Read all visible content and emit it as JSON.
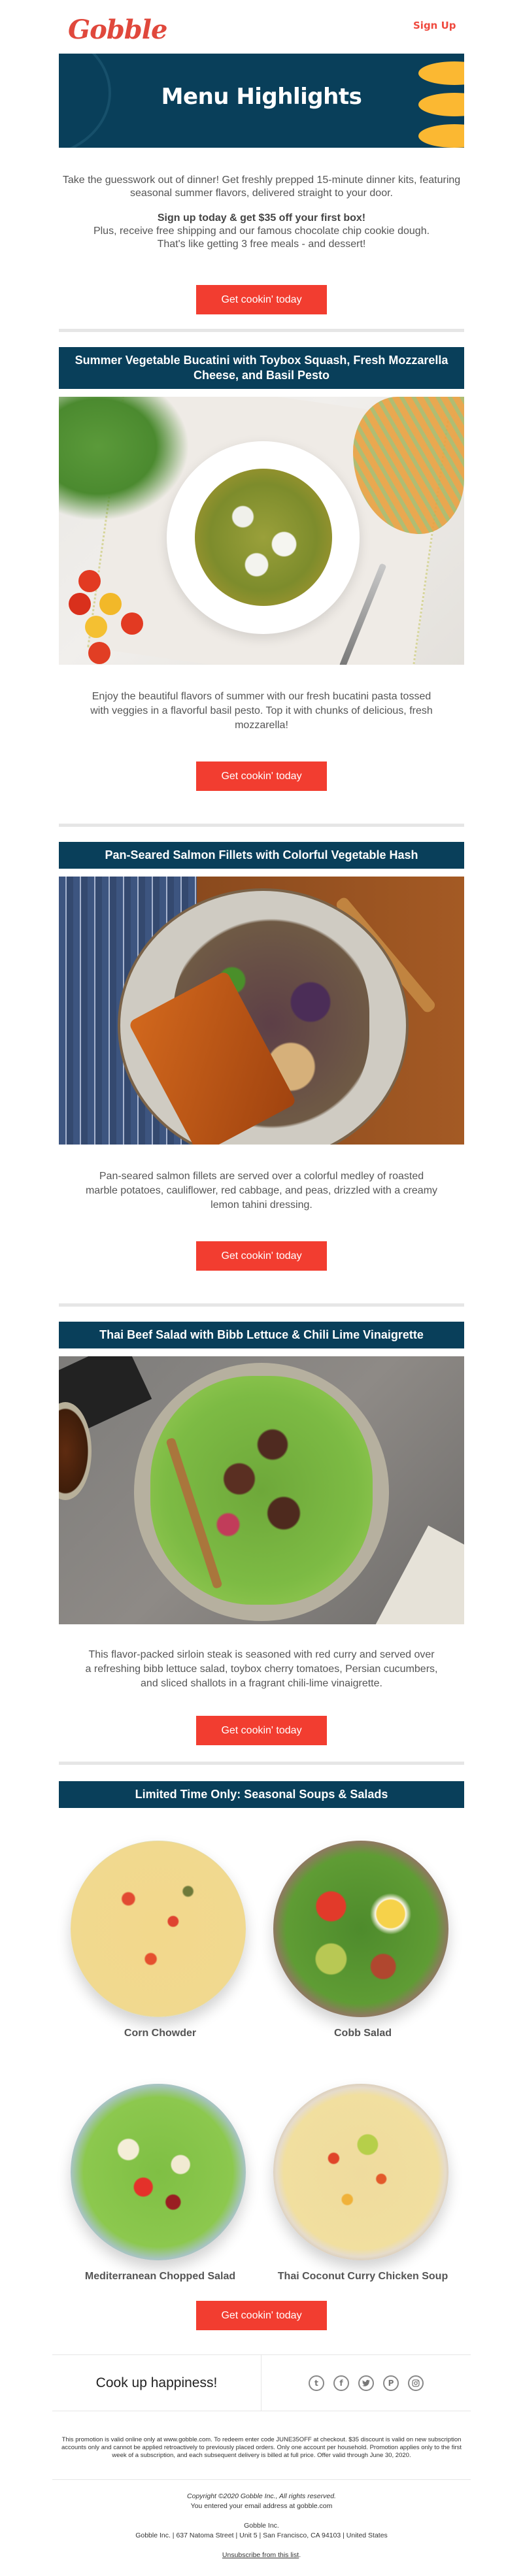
{
  "header": {
    "logo_text": "Gobble",
    "signup_label": "Sign Up"
  },
  "banner": {
    "title": "Menu Highlights",
    "colors": {
      "background": "#093f5a",
      "accent": "#fbb832"
    }
  },
  "intro": {
    "paragraph": "Take the guesswork out of dinner! Get freshly prepped 15-minute dinner kits, featuring seasonal summer flavors, delivered straight to your door.",
    "offer_headline": "Sign up today & get $35 off your first box!",
    "offer_line1": "Plus, receive free shipping and our famous chocolate chip cookie dough.",
    "offer_line2": "That's like getting 3 free meals - and dessert!",
    "cta_label": "Get cookin' today"
  },
  "recipes": [
    {
      "title": "Summer Vegetable Bucatini with Toybox Squash, Fresh Mozzarella Cheese, and Basil Pesto",
      "image_alt": "Bowl of bucatini pasta with vegetables, pesto and mozzarella",
      "description": "Enjoy the beautiful flavors of summer with our fresh bucatini pasta tossed with veggies in a flavorful basil pesto. Top it with chunks of delicious, fresh mozzarella!",
      "cta_label": "Get cookin' today"
    },
    {
      "title": "Pan-Seared Salmon Fillets with Colorful Vegetable Hash",
      "image_alt": "Salmon fillet over roasted vegetable hash",
      "description": "Pan-seared salmon fillets are served over a colorful medley of roasted marble potatoes, cauliflower, red cabbage, and peas, drizzled with a creamy lemon tahini dressing.",
      "cta_label": "Get cookin' today"
    },
    {
      "title": "Thai Beef Salad with Bibb Lettuce & Chili Lime Vinaigrette",
      "image_alt": "Thai beef salad on a plate",
      "description": "This flavor-packed sirloin steak is seasoned with red curry and served over a refreshing bibb lettuce salad, toybox cherry tomatoes, Persian cucumbers, and sliced shallots in a fragrant chili-lime vinaigrette.",
      "cta_label": "Get cookin' today"
    }
  ],
  "seasonal": {
    "title": "Limited Time Only: Seasonal Soups & Salads",
    "items": [
      {
        "name": "Corn Chowder"
      },
      {
        "name": "Cobb Salad"
      },
      {
        "name": "Mediterranean Chopped Salad"
      },
      {
        "name": "Thai Coconut Curry Chicken Soup"
      }
    ],
    "cta_label": "Get cookin' today"
  },
  "social": {
    "tagline": "Cook up happiness!",
    "icons": [
      {
        "name": "tumblr",
        "glyph": "t"
      },
      {
        "name": "facebook",
        "glyph": "f"
      },
      {
        "name": "twitter",
        "glyph": "🐦"
      },
      {
        "name": "pinterest",
        "glyph": "P"
      },
      {
        "name": "instagram",
        "glyph": "◎"
      }
    ]
  },
  "legal": {
    "text": "This promotion is valid online only at www.gobble.com. To redeem enter code JUNE35OFF at checkout. $35 discount is valid on new subscription accounts only and cannot be applied retroactively to previously placed orders. Only one account per household. Promotion applies only to the first week of a subscription, and each subsequent delivery is billed at full price. Offer valid through June 30, 2020."
  },
  "footer": {
    "copyright": "Copyright ©2020 Gobble Inc., All rights reserved.",
    "email_note": "You entered your email address at gobble.com",
    "company": "Gobble Inc.",
    "address": "Gobble Inc. | 637 Natoma Street | Unit 5 | San Francisco, CA 94103 | United States",
    "unsubscribe_label": "Unsubscribe from this list",
    "unsubscribe_suffix": "."
  },
  "colors": {
    "brand_red": "#f23d30",
    "navy": "#093f5a",
    "divider": "#e6e6e6"
  }
}
